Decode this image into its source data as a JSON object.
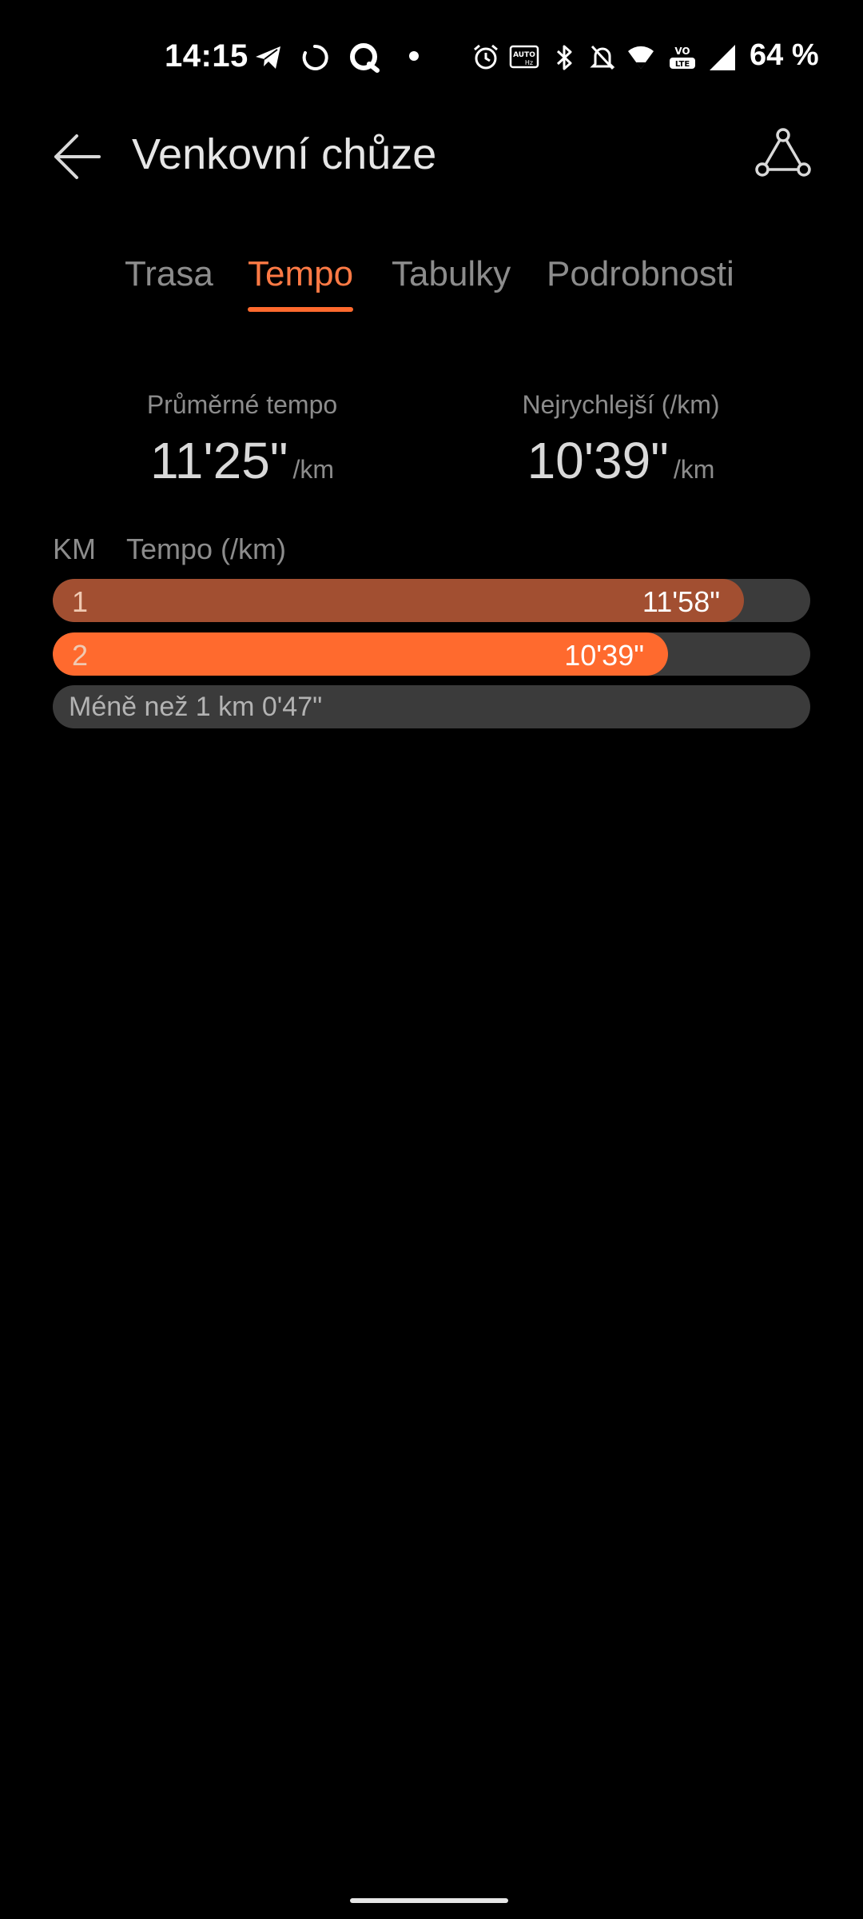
{
  "status_bar": {
    "time": "14:15",
    "battery": "64 %",
    "icons": [
      "telegram-icon",
      "loading-icon",
      "q-app-icon",
      "dot-icon",
      "alarm-icon",
      "auto-hz-icon",
      "bluetooth-icon",
      "mute-icon",
      "wifi-icon",
      "volte-icon",
      "signal-icon"
    ]
  },
  "app_bar": {
    "title": "Venkovní chůze",
    "back_icon": "arrow-left-icon",
    "action_icon": "route-icon"
  },
  "tabs": [
    {
      "label": "Trasa",
      "active": false
    },
    {
      "label": "Tempo",
      "active": true
    },
    {
      "label": "Tabulky",
      "active": false
    },
    {
      "label": "Podrobnosti",
      "active": false
    }
  ],
  "summary": {
    "average": {
      "label": "Průměrné tempo",
      "value": "11'25\"",
      "unit": "/km"
    },
    "fastest": {
      "label": "Nejrychlejší (/km)",
      "value": "10'39\"",
      "unit": "/km"
    }
  },
  "pace_table": {
    "col_km": "KM",
    "col_pace": "Tempo (/km)",
    "rows": [
      {
        "km": "1",
        "pace": "11'58\"",
        "fill_fraction": 0.912,
        "fastest": false
      },
      {
        "km": "2",
        "pace": "10'39\"",
        "fill_fraction": 0.812,
        "fastest": true
      }
    ],
    "remainder": "Méně než 1 km 0'47\""
  },
  "colors": {
    "accent": "#ff6a2e",
    "fill_fastest": "#ff6a2e",
    "fill_normal": "#a24f31",
    "track": "#3b3b3b",
    "background": "#000000"
  }
}
